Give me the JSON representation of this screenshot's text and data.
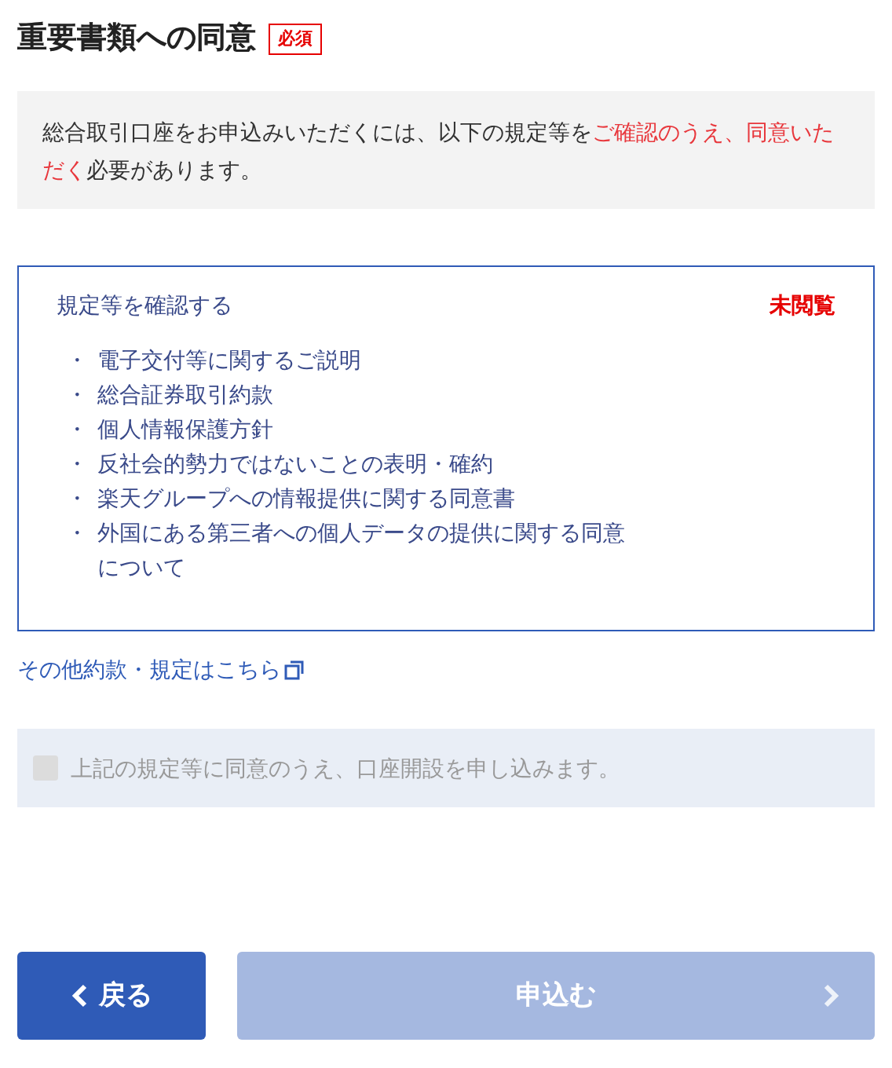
{
  "heading": {
    "title": "重要書類への同意",
    "badge": "必須"
  },
  "notice": {
    "segments": [
      {
        "text": "総合取引口座をお申込みいただくには、以下の規定等を",
        "emphasis": false
      },
      {
        "text": "ご確認のうえ、同意いただく",
        "emphasis": true
      },
      {
        "text": "必要があります。",
        "emphasis": false
      }
    ]
  },
  "documents": {
    "title": "規定等を確認する",
    "status": "未閲覧",
    "items": [
      {
        "bullet": "・",
        "text": "電子交付等に関するご説明"
      },
      {
        "bullet": "・",
        "text": "総合証券取引約款"
      },
      {
        "bullet": "・",
        "text": "個人情報保護方針"
      },
      {
        "bullet": "・",
        "text": "反社会的勢力ではないことの表明・確約"
      },
      {
        "bullet": "・",
        "text": "楽天グループへの情報提供に関する同意書"
      },
      {
        "bullet": "・",
        "text": "外国にある第三者への個人データの提供に関する同意について"
      }
    ]
  },
  "other_link": "その他約款・規定はこちら",
  "agreement": {
    "label": "上記の規定等に同意のうえ、口座開設を申し込みます。",
    "checked": false,
    "disabled": true
  },
  "buttons": [
    {
      "kind": "back",
      "label": "戻る",
      "disabled": false
    },
    {
      "kind": "submit",
      "label": "申込む",
      "disabled": true
    }
  ]
}
